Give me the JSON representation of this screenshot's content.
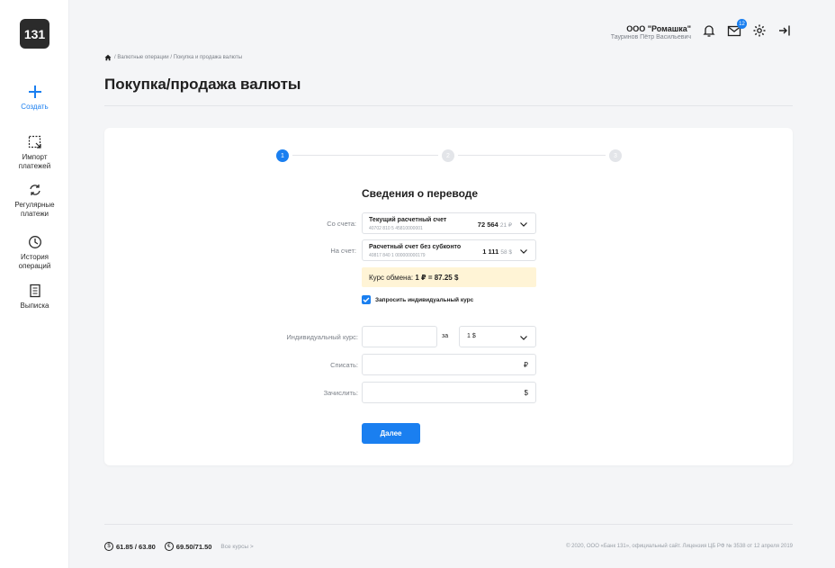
{
  "sidebar": {
    "logo": "131",
    "items": [
      {
        "label": "Создать"
      },
      {
        "label": "Импорт платежей"
      },
      {
        "label": "Регулярные платежи"
      },
      {
        "label": "История операций"
      },
      {
        "label": "Выписка"
      }
    ]
  },
  "header": {
    "company": "ООО \"Ромашка\"",
    "user": "Тауринов Пётр Васильевич",
    "mail_badge": "12"
  },
  "breadcrumb": {
    "path": "/ Валютные операции / Покупка и продажа валюты"
  },
  "page": {
    "title": "Покупка/продажа валюты"
  },
  "steps": [
    "1",
    "2",
    "3"
  ],
  "form": {
    "section_title": "Сведения о переводе",
    "from_label": "Со счета:",
    "from_account": {
      "name": "Текущий расчетный счет",
      "number": "40702 810 5 45810000001",
      "amount_int": "72 564",
      "amount_frac": "21 ₽"
    },
    "to_label": "На счет:",
    "to_account": {
      "name": "Расчетный счет без субконто",
      "number": "40817 840 1 000000000179",
      "amount_int": "1 111",
      "amount_frac": "58 $"
    },
    "rate_prefix": "Курс обмена: ",
    "rate_value": "1 ₽ = 87.25 $",
    "checkbox_label": "Запросить индивидуальный курс",
    "individual_rate_label": "Индивидуальный курс:",
    "za_label": "за",
    "za_select": "1 $",
    "debit_label": "Списать:",
    "debit_suffix": "₽",
    "credit_label": "Зачислить:",
    "credit_suffix": "$",
    "next_button": "Далее"
  },
  "footer": {
    "usd_symbol": "$",
    "usd_rate": "61.85 / 63.80",
    "eur_symbol": "€",
    "eur_rate": "69.50/71.50",
    "all_rates": "Все курсы >",
    "copyright": "© 2020, ООО «Банк 131», официальный сайт. Лицензия ЦБ РФ № 3538 от 12 апреля 2019"
  },
  "colors": {
    "accent": "#1a7ff0",
    "rate_bg": "#fff4d6"
  }
}
